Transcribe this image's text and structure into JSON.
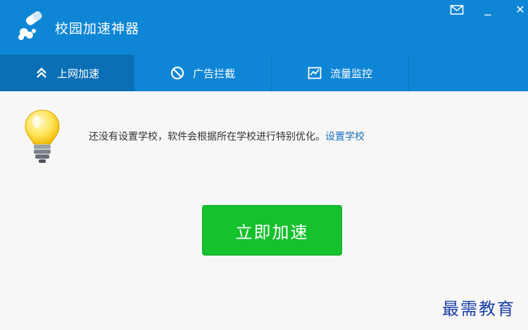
{
  "window": {
    "title": "校园加速神器",
    "controls": {
      "mail_icon": "envelope-icon",
      "minimize": "_",
      "close": "✕"
    }
  },
  "tabs": [
    {
      "label": "上网加速",
      "icon": "double-chevron-up-icon",
      "active": true
    },
    {
      "label": "广告拦截",
      "icon": "block-icon",
      "active": false
    },
    {
      "label": "流量监控",
      "icon": "chart-icon",
      "active": false
    }
  ],
  "main": {
    "notice_text": "还没有设置学校，软件会根据所在学校进行特别优化。",
    "notice_link": "设置学校",
    "accelerate_button": "立即加速"
  },
  "watermark": "最需教育",
  "colors": {
    "header": "#0f86d5",
    "active_tab": "#0a6fb4",
    "button": "#16c12e",
    "link": "#1a6fb6"
  }
}
